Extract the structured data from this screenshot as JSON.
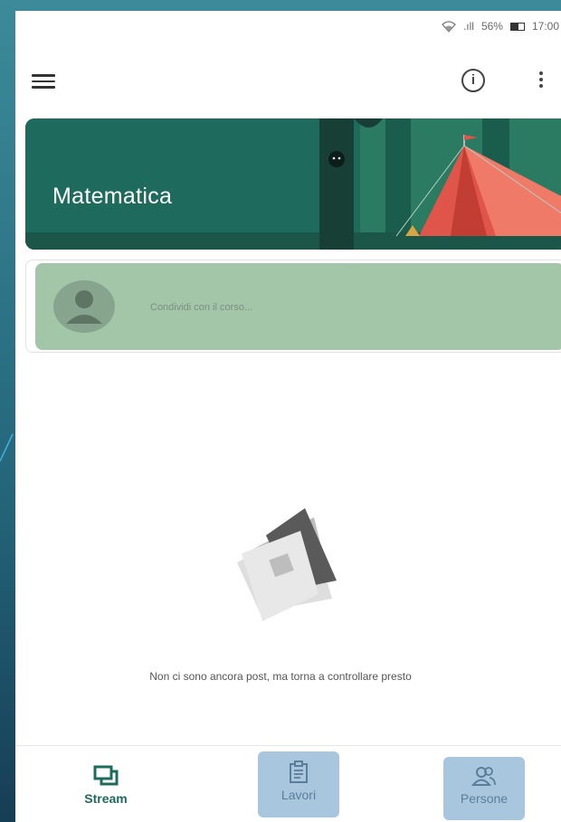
{
  "status_bar": {
    "signal": ".ıll",
    "battery_percent": "56%",
    "time": "17:00"
  },
  "app_bar": {
    "menu_icon": "menu-icon",
    "info_icon": "info-icon",
    "more_icon": "more-vert-icon"
  },
  "course": {
    "title": "Matematica"
  },
  "composer": {
    "placeholder": "Condividi con il corso..."
  },
  "empty_state": {
    "message": "Non ci sono ancora post, ma torna a controllare presto"
  },
  "bottom_nav": {
    "items": [
      {
        "label": "Stream",
        "icon": "stream-icon",
        "active": true
      },
      {
        "label": "Lavori",
        "icon": "clipboard-icon",
        "active": false
      },
      {
        "label": "Persone",
        "icon": "people-icon",
        "active": false
      }
    ]
  },
  "colors": {
    "accent": "#1e6b5e",
    "composer_bg": "#a3c5a8",
    "highlight": "#a9c6df",
    "slide_bg": "#2e7a8c"
  }
}
